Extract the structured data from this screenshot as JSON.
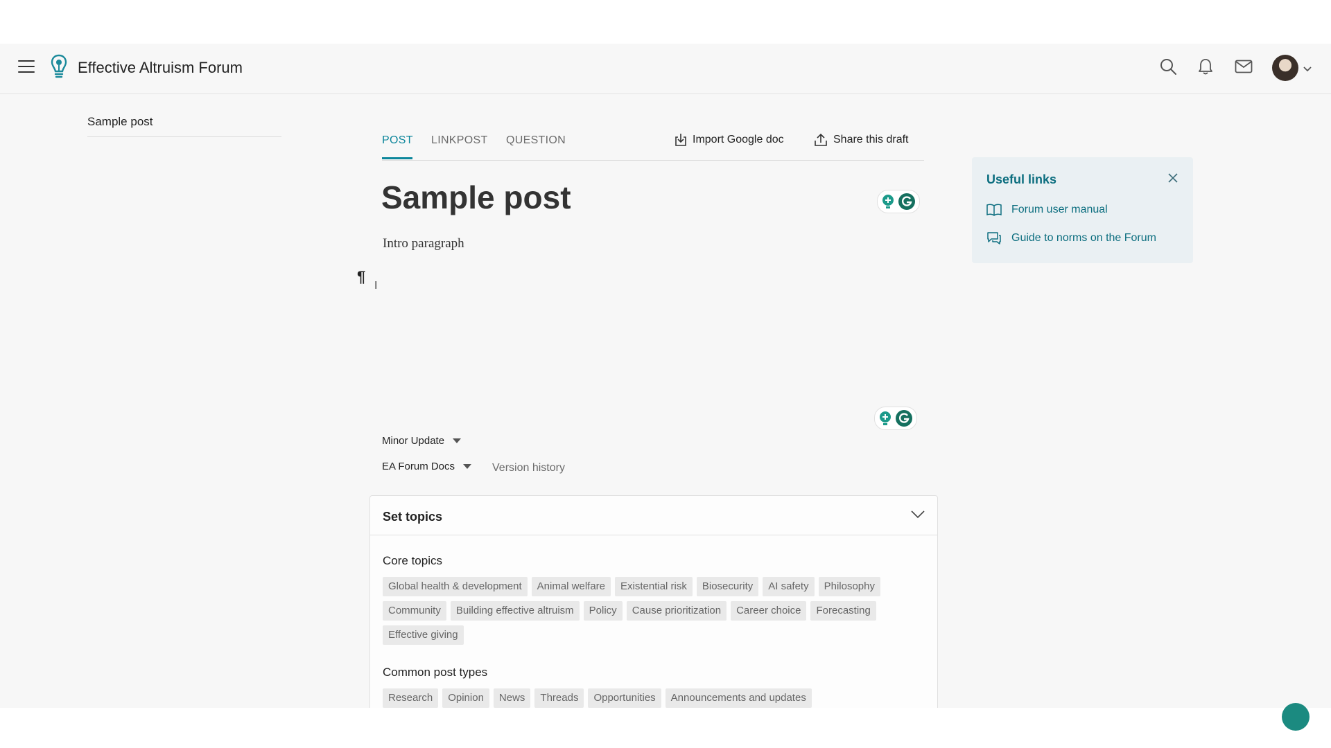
{
  "header": {
    "site_title": "Effective Altruism Forum"
  },
  "toc": {
    "items": [
      "Sample post"
    ]
  },
  "tabs": {
    "post": "POST",
    "linkpost": "LINKPOST",
    "question": "QUESTION",
    "import_label": "Import Google doc",
    "share_label": "Share this draft"
  },
  "editor": {
    "title": "Sample post",
    "intro": "Intro paragraph",
    "pilcrow": "¶",
    "cursor": "I"
  },
  "options": {
    "update_type": "Minor Update",
    "collection": "EA Forum Docs",
    "version_history": "Version history"
  },
  "topics": {
    "title": "Set topics",
    "core_title": "Core topics",
    "core": [
      "Global health & development",
      "Animal welfare",
      "Existential risk",
      "Biosecurity",
      "AI safety",
      "Philosophy",
      "Community",
      "Building effective altruism",
      "Policy",
      "Cause prioritization",
      "Career choice",
      "Forecasting",
      "Effective giving"
    ],
    "post_types_title": "Common post types",
    "post_types": [
      "Research",
      "Opinion",
      "News",
      "Threads",
      "Opportunities",
      "Announcements and updates"
    ]
  },
  "useful_links": {
    "title": "Useful links",
    "links": [
      "Forum user manual",
      "Guide to norms on the Forum"
    ]
  },
  "colors": {
    "accent": "#0c869b",
    "link": "#0c6e7f",
    "chip_bg": "#e9e9e9"
  }
}
